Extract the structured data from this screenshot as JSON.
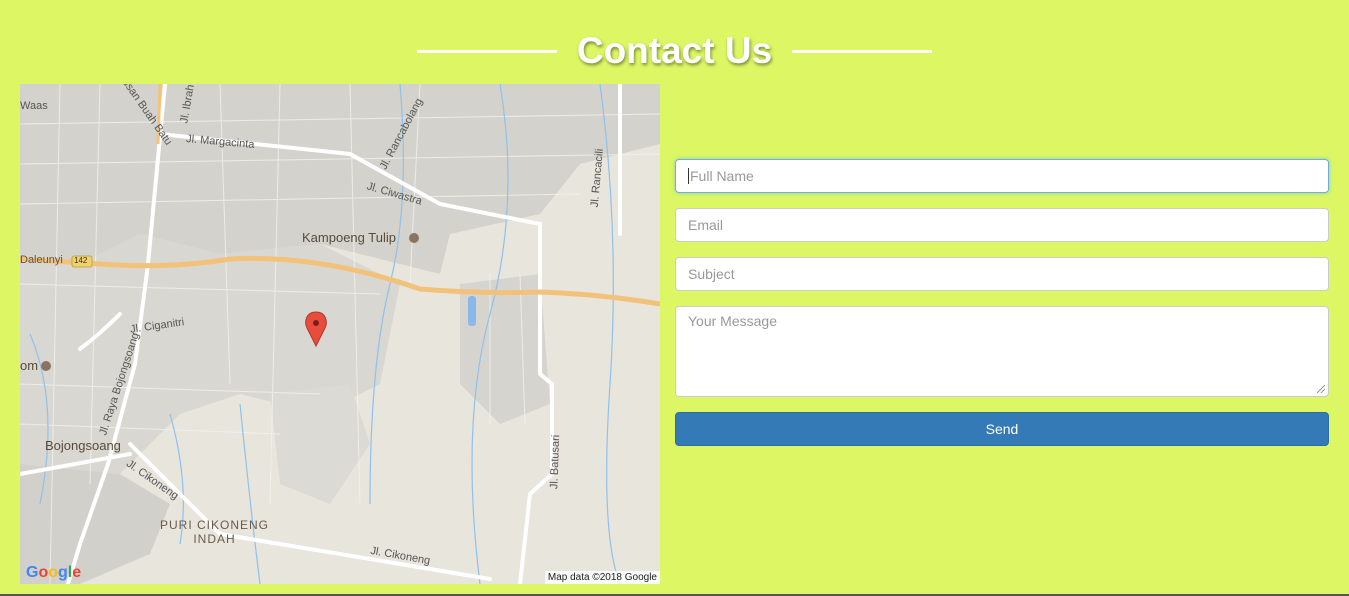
{
  "page": {
    "title": "Contact Us",
    "background_color": "#dcf763",
    "accent_color": "#337ab7"
  },
  "map": {
    "street_labels": {
      "jl_margacinta": "Jl. Margacinta",
      "jl_ciwastra": "Jl. Ciwastra",
      "jl_rancabolang": "Jl. Rancabolang",
      "jl_rancacili": "Jl. Rancacili",
      "jl_ciganitri": "Jl. Ciganitri",
      "jl_raya_bojongsoang": "Jl. Raya Bojongsoang",
      "jl_cikoneng_1": "Jl. Cikoneng",
      "jl_cikoneng_2": "Jl. Cikoneng",
      "jl_batusari": "Jl. Batusari",
      "jl_ibrahim": "Jl. Ibrah",
      "perusahan_buah_batu": "erusan Buah Batu",
      "waas": "Waas",
      "daleunyi": "Daleunyi",
      "route_142": "142"
    },
    "place_labels": {
      "kampoeng_tulip": "Kampoeng Tulip",
      "om_partial": "om",
      "bojongsoang": "Bojongsoang",
      "puri_cikoneng_line1": "PURI CIKONENG",
      "puri_cikoneng_line2": "INDAH"
    },
    "logo": "Google",
    "attribution": "Map data ©2018 Google",
    "marker_icon": "map-pin-icon"
  },
  "form": {
    "full_name": {
      "placeholder": "Full Name",
      "value": ""
    },
    "email": {
      "placeholder": "Email",
      "value": ""
    },
    "subject": {
      "placeholder": "Subject",
      "value": ""
    },
    "message": {
      "placeholder": "Your Message",
      "value": ""
    },
    "send_label": "Send"
  }
}
